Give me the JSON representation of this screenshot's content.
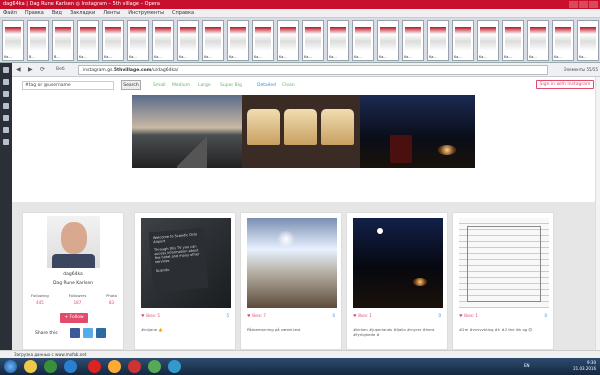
{
  "window": {
    "title": "dag64ka | Dag Rune Karlsen ◎ Instagram – 5th village – Opera"
  },
  "menu": [
    "Файл",
    "Правка",
    "Вид",
    "Закладки",
    "Ленты",
    "Инструменты",
    "Справка"
  ],
  "tabs": [
    "Ka...",
    "В...",
    "В...",
    "Ka...",
    "Ka...",
    "Ka...",
    "Ka...",
    "Ka...",
    "Ka...",
    "Ka...",
    "Ka...",
    "Ka...",
    "Ka...",
    "Ka...",
    "Ka...",
    "Ka...",
    "Ka...",
    "Ka...",
    "Ka...",
    "Ka...",
    "Ka...",
    "Ka...",
    "Ka...",
    "Ka..."
  ],
  "address": {
    "back": "◀",
    "forward": "▶",
    "reload": "⟳",
    "label": "Веб",
    "url_prefix": "instagram.gs.",
    "url_domain": "5thvillage.com",
    "url_suffix": "/u/dag64ka/",
    "right_info": "Элементы  55/55"
  },
  "toolbar": {
    "search_placeholder": "#tag or @username",
    "search_label": "Search",
    "sizes": [
      "Small",
      "Medium",
      "Large",
      "Super Big"
    ],
    "views": [
      "Detailed",
      "Clean"
    ],
    "signin_label": "Sign in with Instagram"
  },
  "profile": {
    "username": "dag64ka",
    "fullname": "Dag Rune Karlsen",
    "following_label": "Following",
    "following": "445",
    "followers_label": "Followers",
    "followers": "187",
    "photos_label": "Photo",
    "photos": "83",
    "follow_label": "+ Follow",
    "share_label": "Share this"
  },
  "posts": [
    {
      "likes": "♥ likes: 5",
      "comments": "5",
      "caption": "#mijane 👍"
    },
    {
      "likes": "♥ likes: 7",
      "comments": "0",
      "caption": "Påskemorning på været.test"
    },
    {
      "likes": "♥ likes: 1",
      "comments": "0",
      "caption": "#kirken #juperlands #fjalla #myrer #hera #fyrlighede #"
    },
    {
      "likes": "♥ likes: 1",
      "comments": "0",
      "caption": "#2m #vvvvvkting #f: #2 the ikk og 😊"
    }
  ],
  "post_text": {
    "welcome": "Welcome to Scandic Oslo Airport",
    "tv_text": "Through this TV you can access information about the hotel and many other services",
    "brand": "Scandic"
  },
  "status": {
    "text": "Загрузка данных с www.mofab.net"
  },
  "taskbar": {
    "lang": "EN",
    "time": "9:30",
    "date": "21.03.2016"
  },
  "colors": {
    "accent": "#e14b6c",
    "opera_red": "#c8102e",
    "link_blue": "#3b8ad6",
    "size_green": "#6cb26c"
  }
}
